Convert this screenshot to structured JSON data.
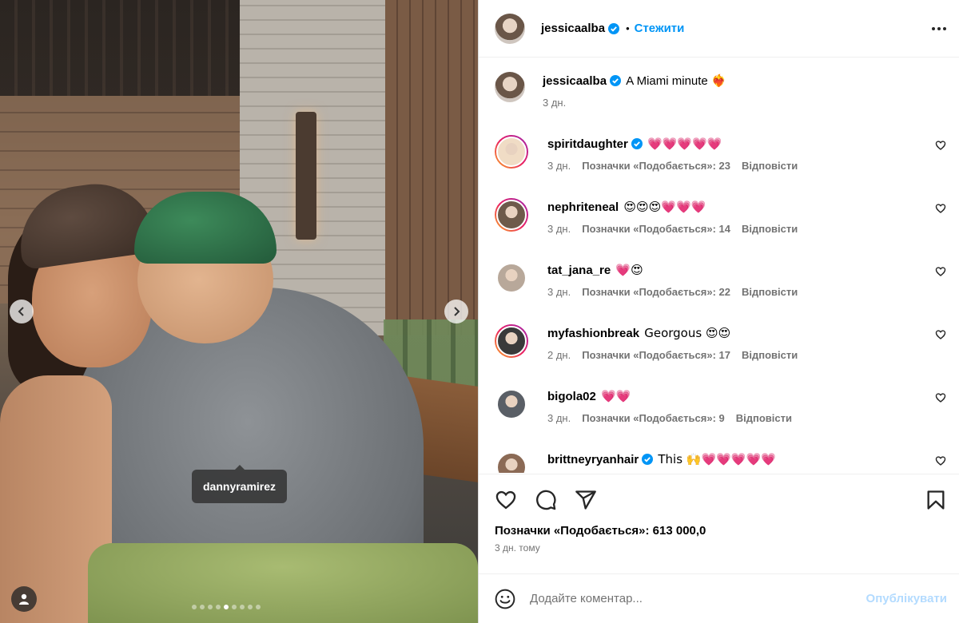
{
  "photo": {
    "tag_label": "dannyramirez",
    "carousel_count": 9,
    "carousel_active": 5
  },
  "post": {
    "author": "jessicaalba",
    "follow_label": "Стежити",
    "caption": "A Miami minute",
    "caption_emoji": "❤️‍🔥",
    "caption_age": "3 дн."
  },
  "comments": [
    {
      "user": "spiritdaughter",
      "verified": true,
      "text": "💗💗💗💗💗",
      "age": "3 дн.",
      "likes": "Позначки «Подобається»: 23",
      "reply": "Відповісти",
      "ring": true,
      "avatar_color": "#f0dcc5"
    },
    {
      "user": "nephriteneal",
      "verified": false,
      "text": "😍😍😍💗💗💗",
      "age": "3 дн.",
      "likes": "Позначки «Подобається»: 14",
      "reply": "Відповісти",
      "ring": true,
      "avatar_color": "#6d5a4a"
    },
    {
      "user": "tat_jana_re",
      "verified": false,
      "text": "💗😍",
      "age": "3 дн.",
      "likes": "Позначки «Подобається»: 22",
      "reply": "Відповісти",
      "ring": false,
      "avatar_color": "#b8a89a"
    },
    {
      "user": "myfashionbreak",
      "verified": false,
      "text": "Georgous 😍😍",
      "age": "2 дн.",
      "likes": "Позначки «Подобається»: 17",
      "reply": "Відповісти",
      "ring": true,
      "avatar_color": "#3a3a3a"
    },
    {
      "user": "bigola02",
      "verified": false,
      "text": "💗💗",
      "age": "3 дн.",
      "likes": "Позначки «Подобається»: 9",
      "reply": "Відповісти",
      "ring": false,
      "avatar_color": "#5a5f66"
    },
    {
      "user": "brittneyryanhair",
      "verified": true,
      "text": "This 🙌💗💗💗💗💗",
      "age": "",
      "likes": "",
      "reply": "",
      "ring": false,
      "avatar_color": "#8b6a55"
    }
  ],
  "footer": {
    "likes_count": "Позначки «Подобається»: 613 000,0",
    "time": "3 дн. тому",
    "comment_placeholder": "Додайте коментар...",
    "post_label": "Опублікувати"
  },
  "icons": {
    "heart": "heart-icon",
    "comment": "comment-icon",
    "share": "share-icon",
    "bookmark": "bookmark-icon",
    "emoji": "emoji-icon",
    "more": "more-icon",
    "verified": "verified-badge-icon"
  },
  "colors": {
    "accent": "#0095f6",
    "post_disabled": "#b3dbff",
    "muted": "#737373",
    "heart": "#ed4956"
  }
}
